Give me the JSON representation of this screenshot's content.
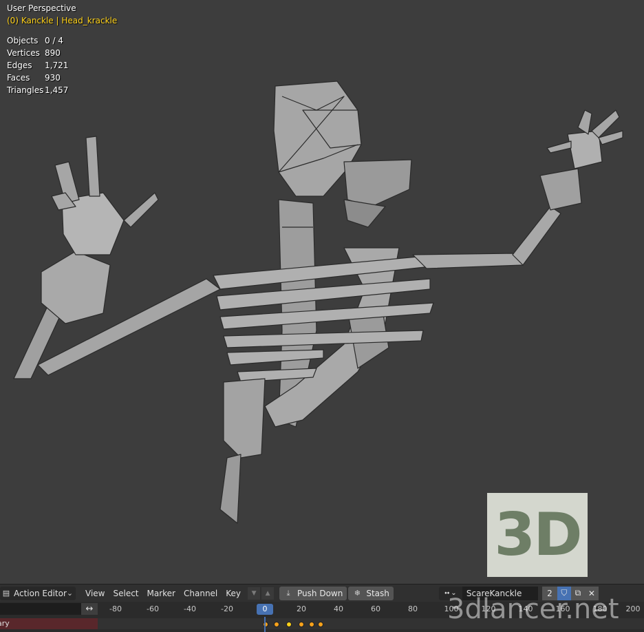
{
  "viewport": {
    "view_name": "User Perspective",
    "active_object": "(0) Kanckle | Head_krackle",
    "stats": [
      {
        "label": "Objects",
        "value": "0 / 4"
      },
      {
        "label": "Vertices",
        "value": "890"
      },
      {
        "label": "Edges",
        "value": "1,721"
      },
      {
        "label": "Faces",
        "value": "930"
      },
      {
        "label": "Triangles",
        "value": "1,457"
      }
    ]
  },
  "watermark": {
    "badge": "3D",
    "site": "3dlancer.net"
  },
  "header": {
    "editor_type": "Action Editor",
    "menus": [
      "View",
      "Select",
      "Marker",
      "Channel",
      "Key"
    ],
    "push_down": "Push Down",
    "stash": "Stash",
    "action_name": "ScareKanckle",
    "users": "2"
  },
  "timeline": {
    "ticks": [
      "-80",
      "-60",
      "-40",
      "-20",
      "0",
      "20",
      "40",
      "60",
      "80",
      "100",
      "120",
      "140",
      "160",
      "180",
      "200"
    ],
    "current_frame": "0",
    "summary_label": "ary"
  },
  "colors": {
    "accent": "#4772b3",
    "keyframe": "#f7a21b",
    "active_text": "#ffd21a",
    "summary": "#59272b"
  },
  "icons": [
    "keying-icon",
    "push-down-icon",
    "stash-icon",
    "browse-action-icon",
    "fake-user-shield-icon",
    "duplicate-icon",
    "close-icon",
    "swap-arrows-icon"
  ]
}
